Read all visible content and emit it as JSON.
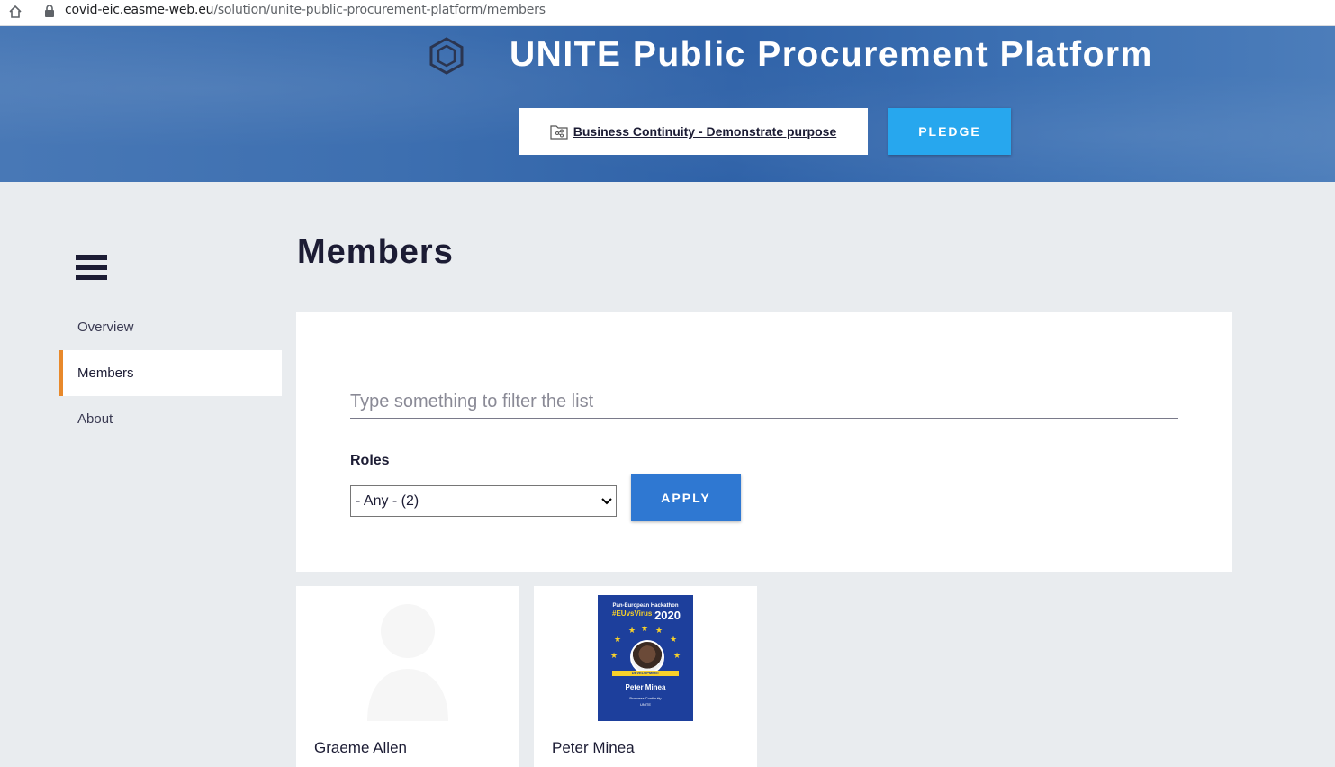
{
  "browser": {
    "url_host": "covid-eic.easme-web.eu",
    "url_path": "/solution/unite-public-procurement-platform/members"
  },
  "header": {
    "title": "UNITE Public Procurement Platform",
    "challenge_link": "Business Continuity - Demonstrate purpose",
    "pledge_label": "PLEDGE"
  },
  "sidebar": {
    "items": [
      {
        "label": "Overview",
        "active": false
      },
      {
        "label": "Members",
        "active": true
      },
      {
        "label": "About",
        "active": false
      }
    ]
  },
  "main": {
    "page_title": "Members",
    "filter": {
      "placeholder": "Type something to filter the list",
      "value": "",
      "roles_label": "Roles",
      "roles_selected": "- Any - (2)",
      "apply_label": "APPLY"
    },
    "members": [
      {
        "name": "Graeme Allen",
        "avatar": "placeholder-person-icon"
      },
      {
        "name": "Peter Minea",
        "avatar": "hackathon-poster",
        "poster": {
          "heading": "Pan-European Hackathon",
          "hashtag": "#EUvsVirus",
          "year": "2020",
          "ribbon": "DEVELOPMENT",
          "name": "Peter Minea",
          "line1": "Business Continuity",
          "line2": "UNITE"
        }
      }
    ]
  },
  "colors": {
    "accent_orange": "#e8892b",
    "pledge_blue": "#27a7ee",
    "apply_blue": "#2f78d2",
    "navy": "#1c1c34"
  }
}
